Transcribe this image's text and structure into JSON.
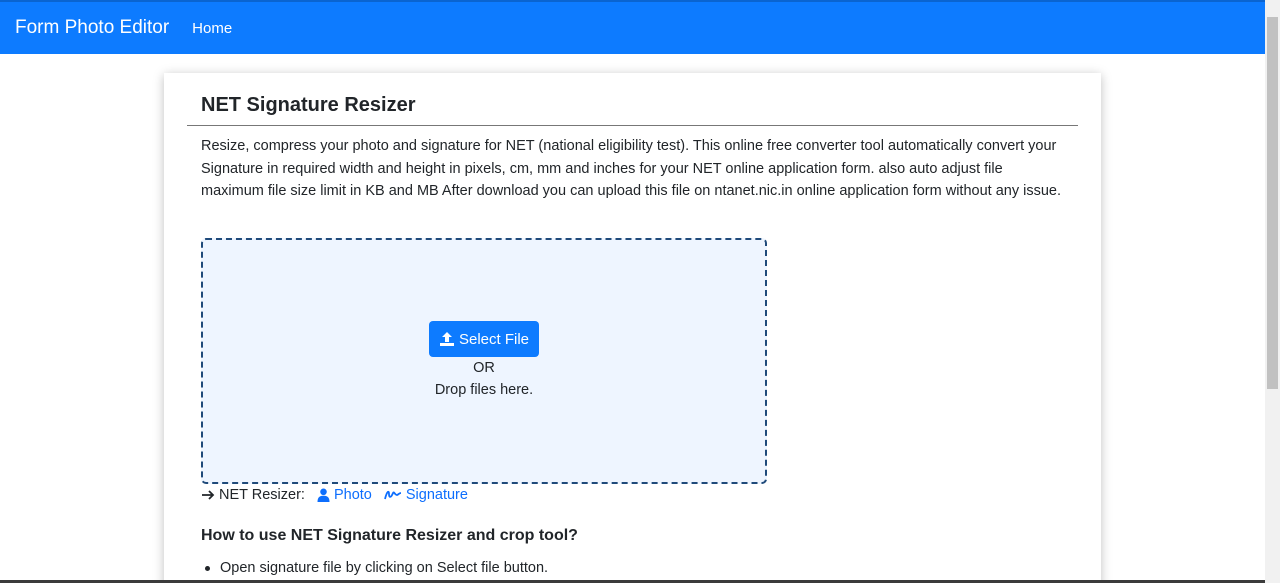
{
  "navbar": {
    "brand": "Form Photo Editor",
    "home": "Home",
    "color": "#0d7bff"
  },
  "main": {
    "title": "NET Signature Resizer",
    "intro": "Resize, compress your photo and signature for NET (national eligibility test). This online free converter tool automatically convert your Signature in required width and height in pixels, cm, mm and inches for your NET online application form. also auto adjust file maximum file size limit in KB and MB After download you can upload this file on ntanet.nic.in online application form without any issue.",
    "dropzone": {
      "select_label": "Select File",
      "or_label": "OR",
      "drop_label": "Drop files here."
    },
    "resizer_links": {
      "label": "NET Resizer:",
      "photo": "Photo",
      "signature": "Signature"
    },
    "how_title": "How to use NET Signature Resizer and crop tool?",
    "steps": [
      "Open signature file by clicking on Select file button."
    ]
  },
  "icons": {
    "upload": "upload-icon",
    "arrow": "arrow-right-icon",
    "person": "person-icon",
    "signature": "signature-icon"
  }
}
